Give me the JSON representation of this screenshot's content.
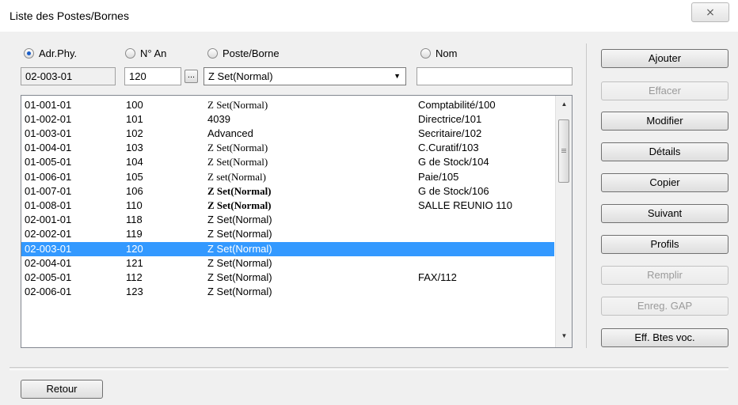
{
  "window": {
    "title": "Liste des Postes/Bornes",
    "close_glyph": "⨯"
  },
  "filters": {
    "radios": [
      {
        "label": "Adr.Phy.",
        "checked": true
      },
      {
        "label": "N° An",
        "checked": false
      },
      {
        "label": "Poste/Borne",
        "checked": false
      },
      {
        "label": "Nom",
        "checked": false
      }
    ],
    "adr_value": "02-003-01",
    "num_value": "120",
    "browse_label": "...",
    "poste_selected": "Z Set(Normal)",
    "nom_value": ""
  },
  "list": {
    "rows": [
      {
        "adr": "01-001-01",
        "num": "100",
        "poste": "Z Set(Normal)",
        "nom": "Comptabilité/100"
      },
      {
        "adr": "01-002-01",
        "num": "101",
        "poste": "4039",
        "nom": "Directrice/101"
      },
      {
        "adr": "01-003-01",
        "num": "102",
        "poste": "Advanced",
        "nom": "Secritaire/102"
      },
      {
        "adr": "01-004-01",
        "num": "103",
        "poste": "Z Set(Normal)",
        "nom": "C.Curatif/103"
      },
      {
        "adr": "01-005-01",
        "num": "104",
        "poste": "Z Set(Normal)",
        "nom": "G de Stock/104"
      },
      {
        "adr": "01-006-01",
        "num": "105",
        "poste": "Z set(Normal)",
        "nom": "Paie/105"
      },
      {
        "adr": "01-007-01",
        "num": "106",
        "poste": "Z Set(Normal)",
        "nom": "G de Stock/106"
      },
      {
        "adr": "01-008-01",
        "num": "110",
        "poste": "Z Set(Normal)",
        "nom": "SALLE REUNIO 110"
      },
      {
        "adr": "02-001-01",
        "num": "118",
        "poste": "Z Set(Normal)",
        "nom": ""
      },
      {
        "adr": "02-002-01",
        "num": "119",
        "poste": "Z Set(Normal)",
        "nom": ""
      },
      {
        "adr": "02-003-01",
        "num": "120",
        "poste": "Z Set(Normal)",
        "nom": ""
      },
      {
        "adr": "02-004-01",
        "num": "121",
        "poste": "Z Set(Normal)",
        "nom": ""
      },
      {
        "adr": "02-005-01",
        "num": "112",
        "poste": "Z Set(Normal)",
        "nom": "FAX/112"
      },
      {
        "adr": "02-006-01",
        "num": "123",
        "poste": "Z Set(Normal)",
        "nom": ""
      }
    ]
  },
  "buttons": {
    "ajouter": "Ajouter",
    "effacer": "Effacer",
    "modifier": "Modifier",
    "details": "Détails",
    "copier": "Copier",
    "suivant": "Suivant",
    "profils": "Profils",
    "remplir": "Remplir",
    "enreg_gap": "Enreg. GAP",
    "eff_btes_voc": "Eff. Btes voc.",
    "retour": "Retour"
  },
  "colors": {
    "selection": "#3399ff",
    "disabled_text": "#9a9a9a"
  }
}
